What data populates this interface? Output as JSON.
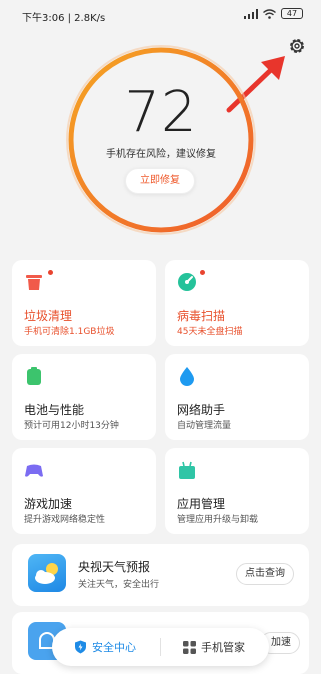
{
  "status_bar": {
    "time_speed": "下午3:06 | 2.8K/s",
    "battery": "47"
  },
  "score": {
    "value": "72",
    "description": "手机存在风险，建议修复",
    "repair_button": "立即修复"
  },
  "tiles": [
    {
      "title": "垃圾清理",
      "subtitle": "手机可清除1.1GB垃圾",
      "icon": "trash-icon",
      "alert": true
    },
    {
      "title": "病毒扫描",
      "subtitle": "45天未全盘扫描",
      "icon": "virus-scan-icon",
      "alert": true
    },
    {
      "title": "电池与性能",
      "subtitle": "预计可用12小时13分钟",
      "icon": "battery-icon",
      "alert": false
    },
    {
      "title": "网络助手",
      "subtitle": "自动管理流量",
      "icon": "network-drop-icon",
      "alert": false
    },
    {
      "title": "游戏加速",
      "subtitle": "提升游戏网络稳定性",
      "icon": "gamepad-icon",
      "alert": false
    },
    {
      "title": "应用管理",
      "subtitle": "管理应用升级与卸载",
      "icon": "app-manage-icon",
      "alert": false
    }
  ],
  "weather": {
    "title": "央视天气预报",
    "subtitle": "关注天气，安全出行",
    "button": "点击查询"
  },
  "partial_card": {
    "button": "加速"
  },
  "bottom_nav": {
    "left": "安全中心",
    "right": "手机管家"
  },
  "colors": {
    "accent_orange": "#f07a2e",
    "alert_red": "#e8502c",
    "nav_blue": "#1e8be6"
  }
}
